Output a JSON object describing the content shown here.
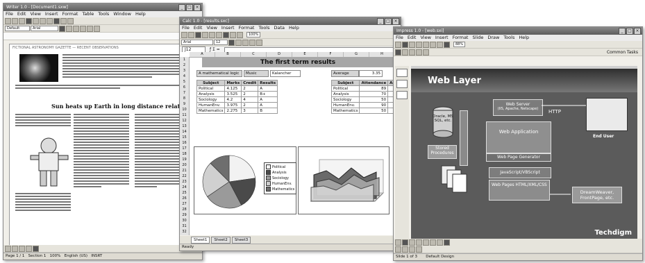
{
  "writer": {
    "title": "Writer 1.0 - [Document1.sxw]",
    "menu": [
      "File",
      "Edit",
      "View",
      "Insert",
      "Format",
      "Table",
      "Tools",
      "Window",
      "Help"
    ],
    "style_box": "Default",
    "font_box": "Arial",
    "header_text": "FICTIONAL ASTRONOMY GAZETTE  —  RECENT OBSERVATIONS",
    "article_title": "Sun heats up Earth in long distance relationship",
    "status": {
      "page": "Page 1 / 1",
      "section": "Section 1",
      "zoom": "100%",
      "lang": "English (US)",
      "mode": "INSRT"
    }
  },
  "calc": {
    "title": "Calc 1.0 - [results.sxc]",
    "menu": [
      "File",
      "Edit",
      "View",
      "Insert",
      "Format",
      "Tools",
      "Data",
      "Help"
    ],
    "font_box": "Arial",
    "size_box": "12",
    "zoom": "100%",
    "cell_ref": "J12",
    "sheet_title": "The first term results",
    "name_label": "A mathematical logic",
    "name_value": "Music",
    "name_value2": "Kalancher",
    "average_label": "Average",
    "average_value": "3.35",
    "col_headers": [
      "A",
      "B",
      "C",
      "D",
      "E",
      "F",
      "G",
      "H"
    ],
    "row_numbers": [
      "1",
      "2",
      "3",
      "4",
      "5",
      "6",
      "7",
      "8",
      "9",
      "10",
      "11",
      "12",
      "13",
      "14",
      "15",
      "16",
      "17",
      "18",
      "19",
      "20",
      "21",
      "22",
      "23",
      "24",
      "25",
      "26",
      "27",
      "28",
      "29",
      "30",
      "31",
      "32",
      "33",
      "34",
      "35"
    ],
    "table1": {
      "headers": [
        "Subject",
        "Marks",
        "Credit",
        "Results"
      ],
      "rows": [
        [
          "Political",
          "4.125",
          "2",
          "A"
        ],
        [
          "Analysis",
          "3.525",
          "2",
          "B+"
        ],
        [
          "Sociology",
          "4.2",
          "4",
          "A"
        ],
        [
          "HumanEnv.",
          "3.975",
          "2",
          "A"
        ],
        [
          "Mathematics",
          "2.275",
          "3",
          "B"
        ]
      ]
    },
    "table2": {
      "headers": [
        "Subject",
        "Attendance",
        "Assign."
      ],
      "rows": [
        [
          "Political",
          "89",
          ""
        ],
        [
          "Analysis",
          "70",
          ""
        ],
        [
          "Sociology",
          "50",
          ""
        ],
        [
          "HumanEnv.",
          "90",
          ""
        ],
        [
          "Mathematics",
          "50",
          ""
        ]
      ]
    },
    "legend": [
      "Political",
      "Analysis",
      "Sociology",
      "HumanEnv.",
      "Mathematics"
    ],
    "tabs": [
      "Sheet1",
      "Sheet2",
      "Sheet3"
    ],
    "status": "Ready"
  },
  "impress": {
    "title": "Impress 1.0 - [web.sxi]",
    "menu": [
      "File",
      "Edit",
      "View",
      "Insert",
      "Format",
      "Slide",
      "Draw",
      "Tools",
      "Help"
    ],
    "zoom": "88%",
    "tasks_label": "Common Tasks",
    "slide": {
      "title": "Web Layer",
      "web_server": "Web Server",
      "web_server_sub": "(IIS, Apache, Netscape)",
      "http": "HTTP",
      "db": "Oracle, MS SQL, etc.",
      "app": "Web Application",
      "web_page_generator": "Web Page Generator",
      "stored": "Stored Procedures",
      "javascript": "JavaScript/VBScript",
      "web_pages": "Web Pages HTML/XML/CSS",
      "end_user": "End User",
      "designer": "DreamWeaver, FrontPage, etc.",
      "brand": "Techdigm"
    },
    "status": {
      "slide": "Slide 1 of 3",
      "layout": "Default Design"
    }
  },
  "colors": {
    "pie": [
      "#f2f2f2",
      "#4a4a4a",
      "#9a9a9a",
      "#d0d0d0",
      "#6e6e6e"
    ]
  }
}
